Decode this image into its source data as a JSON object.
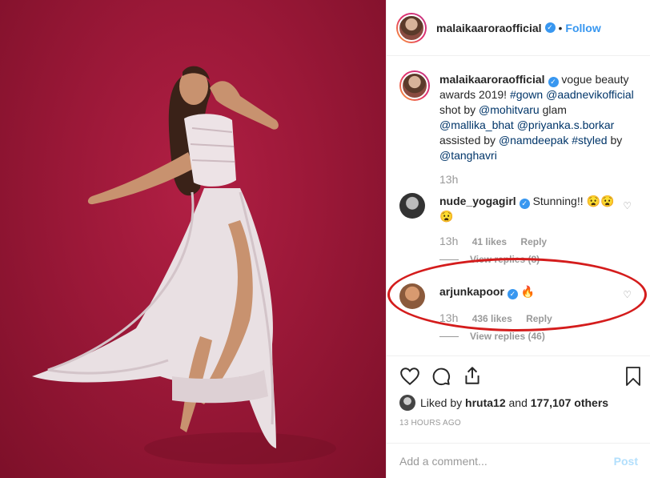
{
  "header": {
    "username": "malaikaaroraofficial",
    "follow_label": "Follow",
    "separator": "•"
  },
  "caption": {
    "username": "malaikaaroraofficial",
    "parts": [
      {
        "text": "vogue beauty awards 2019! ",
        "type": "text"
      },
      {
        "text": "#gown",
        "type": "tag"
      },
      {
        "text": " ",
        "type": "text"
      },
      {
        "text": "@aadnevikofficial",
        "type": "tag"
      },
      {
        "text": " shot by ",
        "type": "text"
      },
      {
        "text": "@mohitvaru",
        "type": "tag"
      },
      {
        "text": " glam ",
        "type": "text"
      },
      {
        "text": "@mallika_bhat",
        "type": "tag"
      },
      {
        "text": " ",
        "type": "text"
      },
      {
        "text": "@priyanka.s.borkar",
        "type": "tag"
      },
      {
        "text": " assisted by ",
        "type": "text"
      },
      {
        "text": "@namdeepak",
        "type": "tag"
      },
      {
        "text": " ",
        "type": "text"
      },
      {
        "text": "#styled",
        "type": "tag"
      },
      {
        "text": " by ",
        "type": "text"
      },
      {
        "text": "@tanghavri",
        "type": "tag"
      }
    ],
    "time": "13h"
  },
  "comments": [
    {
      "username": "nude_yogagirl",
      "verified": true,
      "text": "Stunning!! 😧😧 😧",
      "time": "13h",
      "likes": "41 likes",
      "reply": "Reply",
      "view_replies": "View replies (8)"
    },
    {
      "username": "arjunkapoor",
      "verified": true,
      "text": "🔥",
      "time": "13h",
      "likes": "436 likes",
      "reply": "Reply",
      "view_replies": "View replies (46)"
    }
  ],
  "likes": {
    "by_user": "hruta12",
    "liked_by_prefix": "Liked by",
    "and": "and",
    "others": "177,107 others"
  },
  "timestamp": "13 HOURS AGO",
  "add_comment": {
    "placeholder": "Add a comment...",
    "post_label": "Post"
  },
  "colors": {
    "accent": "#3897f0",
    "backdrop": "#9b1838",
    "annotation": "#d41c1c"
  },
  "icons": [
    "verified-icon",
    "heart-icon",
    "comment-icon",
    "share-icon",
    "bookmark-icon"
  ]
}
